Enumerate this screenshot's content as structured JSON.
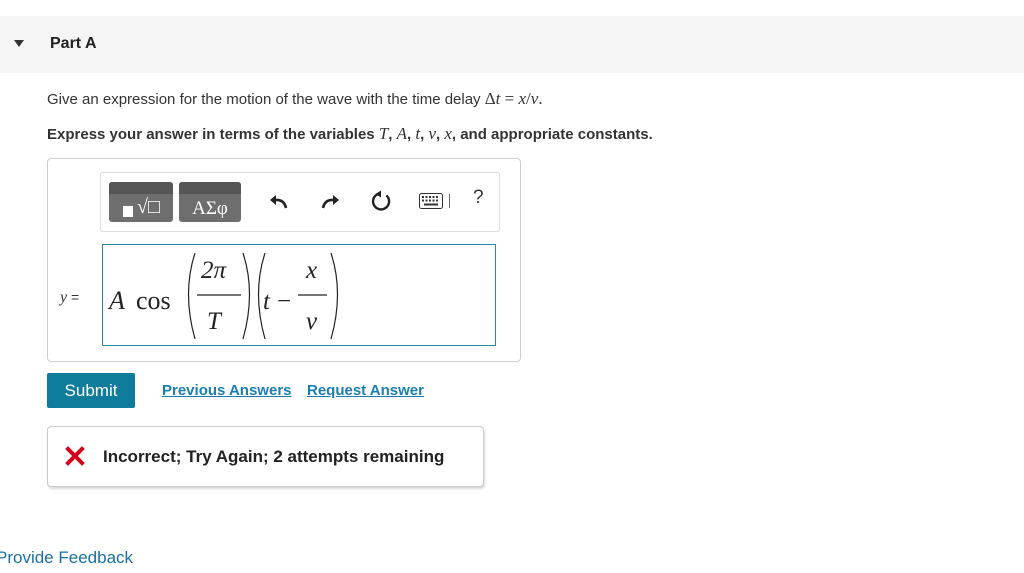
{
  "part": {
    "title": "Part A"
  },
  "question": {
    "prompt_text": "Give an expression for the motion of the wave with the time delay",
    "prompt_math": {
      "delta": "Δ",
      "t": "t",
      "eq": " = ",
      "x": "x",
      "slash": "/",
      "v": "v",
      "end": "."
    },
    "instruction_lead": "Express your answer in terms of the variables",
    "instruction_vars": {
      "T": "T",
      "A": "A",
      "t": "t",
      "v": "v",
      "x": "x"
    },
    "instruction_sep": ", ",
    "instruction_and": ", and appropriate constants."
  },
  "toolbar": {
    "greek_label": "ΑΣφ",
    "root_symbol": "√□",
    "help_label": "?"
  },
  "answer": {
    "lhs": "y",
    "lhs_eq": " =",
    "expr": {
      "A": "A",
      "cos": "cos",
      "two_pi": "2π",
      "T": "T",
      "t": "t",
      "minus": "−",
      "x": "x",
      "v": "v"
    }
  },
  "actions": {
    "submit": "Submit",
    "previous_answers": "Previous Answers",
    "request_answer": "Request Answer"
  },
  "feedback": {
    "message": "Incorrect; Try Again; 2 attempts remaining"
  },
  "footer": {
    "provide_feedback": "Provide Feedback"
  },
  "colors": {
    "accent": "#0e7c9a",
    "link": "#1a7fb0",
    "error": "#d0021b",
    "input_border": "#2a8ba0"
  },
  "icons": [
    "chevron-down-icon",
    "undo-icon",
    "redo-icon",
    "reset-icon",
    "keyboard-icon",
    "help-icon",
    "error-x-icon"
  ]
}
